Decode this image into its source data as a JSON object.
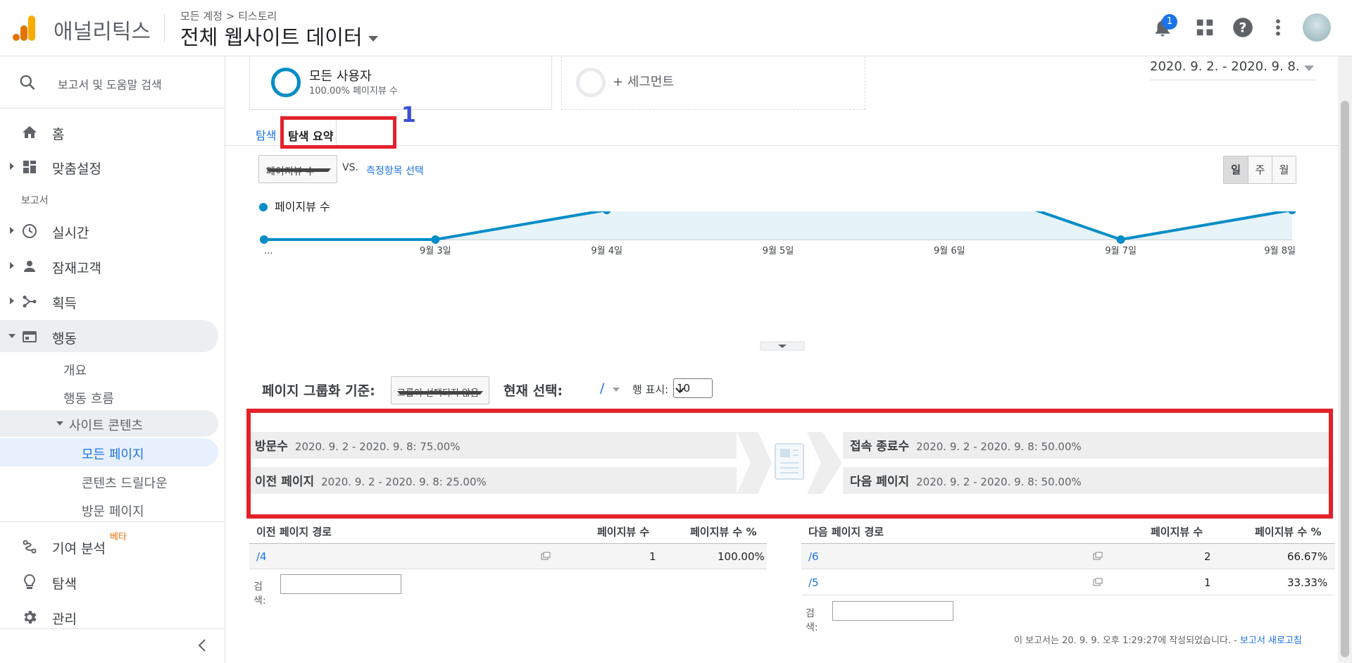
{
  "header": {
    "app_name": "애널리틱스",
    "breadcrumb_account": "모든 계정",
    "breadcrumb_sep": ">",
    "breadcrumb_property": "티스토리",
    "view_name": "전체 웹사이트 데이터",
    "notification_count": "1",
    "colors": {
      "logo_orange": "#f9ab00",
      "logo_dark": "#e37400",
      "accent": "#1a73e8"
    }
  },
  "sidebar": {
    "search_label": "보고서 및 도움말 검색",
    "home": "홈",
    "customization": "맞춤설정",
    "reports_section": "보고서",
    "realtime": "실시간",
    "audience": "잠재고객",
    "acquisition": "획득",
    "behavior": "행동",
    "behavior_sub": {
      "overview": "개요",
      "behavior_flow": "행동 흐름",
      "site_content": "사이트 콘텐츠",
      "all_pages": "모든 페이지",
      "content_drilldown": "콘텐츠 드릴다운",
      "landing_pages": "방문 페이지"
    },
    "attribution": "기여 분석",
    "beta_label": "베타",
    "discover": "탐색",
    "admin": "관리"
  },
  "segments": {
    "all_users_name": "모든 사용자",
    "all_users_sub": "100.00% 페이지뷰 수",
    "add_segment": "+ 세그먼트"
  },
  "date_range": "2020. 9. 2. - 2020. 9. 8.",
  "tabs": {
    "explore": "탐색",
    "nav_summary": "탐색 요약",
    "annotation_number": "1"
  },
  "controls": {
    "metric_select": "페이지뷰 수",
    "vs": "VS.",
    "compare_metric": "측정항목 선택",
    "day": "일",
    "week": "주",
    "month": "월"
  },
  "chart_data": {
    "type": "area",
    "categories": [
      "...",
      "9월 3일",
      "9월 4일",
      "9월 5일",
      "9월 6일",
      "9월 7일",
      "9월 8일"
    ],
    "series": [
      {
        "name": "페이지뷰 수",
        "values": [
          0,
          0,
          1,
          4,
          2,
          0,
          1
        ]
      }
    ],
    "yticks": [
      "2",
      "4"
    ],
    "ylim": [
      0,
      4
    ],
    "grid": true,
    "legend": "top-left",
    "color": "#058dc7"
  },
  "grouping": {
    "label": "페이지 그룹화 기준:",
    "select": "그룹이 선택되지 않음",
    "current_label": "현재 선택:",
    "current_value": "/",
    "rows_label": "행 표시:",
    "rows_value": "10"
  },
  "flow": {
    "entrances_label": "방문수",
    "entrances_value": "2020. 9. 2 - 2020. 9. 8: 75.00%",
    "prev_label": "이전 페이지",
    "prev_value": "2020. 9. 2 - 2020. 9. 8: 25.00%",
    "exits_label": "접속 종료수",
    "exits_value": "2020. 9. 2 - 2020. 9. 8: 50.00%",
    "next_label": "다음 페이지",
    "next_value": "2020. 9. 2 - 2020. 9. 8: 50.00%"
  },
  "prev_table": {
    "headers": [
      "이전 페이지 경로",
      "페이지뷰 수",
      "페이지뷰 수 %"
    ],
    "rows": [
      {
        "path": "/4",
        "views": "1",
        "pct": "100.00%"
      }
    ],
    "search_label": "검색:"
  },
  "next_table": {
    "headers": [
      "다음 페이지 경로",
      "페이지뷰 수",
      "페이지뷰 수 %"
    ],
    "rows": [
      {
        "path": "/6",
        "views": "2",
        "pct": "66.67%"
      },
      {
        "path": "/5",
        "views": "1",
        "pct": "33.33%"
      }
    ],
    "search_label": "검색:"
  },
  "footer": {
    "note": "이 보고서는 20. 9. 9. 오후 1:29:27에 작성되었습니다. -",
    "refresh_link": "보고서 새로고침"
  }
}
